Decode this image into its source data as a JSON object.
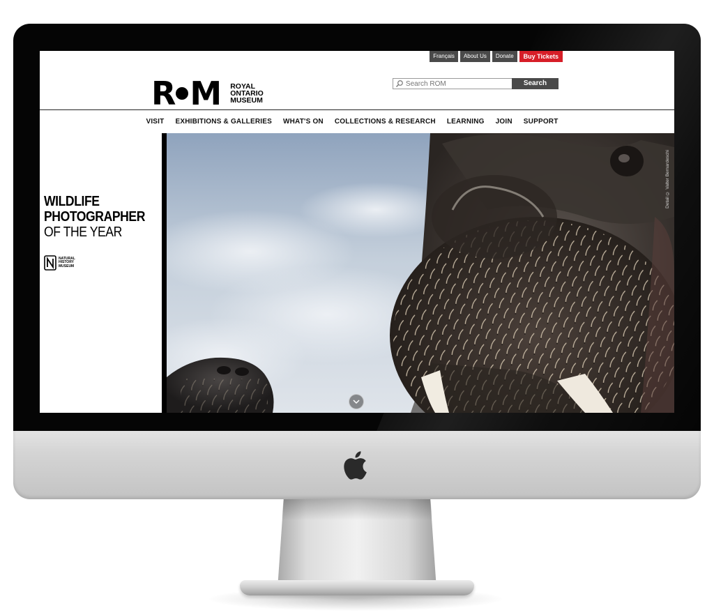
{
  "utility_nav": [
    {
      "label": "Français"
    },
    {
      "label": "About Us"
    },
    {
      "label": "Donate"
    },
    {
      "label": "Buy Tickets"
    }
  ],
  "brand": {
    "mark": "ROM",
    "name_lines": [
      "ROYAL",
      "ONTARIO",
      "MUSEUM"
    ]
  },
  "search": {
    "placeholder": "Search ROM",
    "button_label": "Search"
  },
  "main_nav": [
    {
      "label": "VISIT"
    },
    {
      "label": "EXHIBITIONS & GALLERIES"
    },
    {
      "label": "WHAT'S ON"
    },
    {
      "label": "COLLECTIONS & RESEARCH"
    },
    {
      "label": "LEARNING"
    },
    {
      "label": "JOIN"
    },
    {
      "label": "SUPPORT"
    }
  ],
  "hero": {
    "title_lines": [
      "WILDLIFE",
      "PHOTOGRAPHER"
    ],
    "subtitle": "OF THE YEAR",
    "partner_logo_lines": [
      "NATURAL",
      "HISTORY",
      "MUSEUM"
    ],
    "photo_credit": "Detail © Valter Bernardeschi"
  },
  "colors": {
    "accent_red": "#d71e28",
    "utility_gray": "#4a4a4a",
    "text_black": "#000000"
  },
  "icons": [
    "apple-logo-icon",
    "search-icon",
    "chevron-down-icon"
  ]
}
